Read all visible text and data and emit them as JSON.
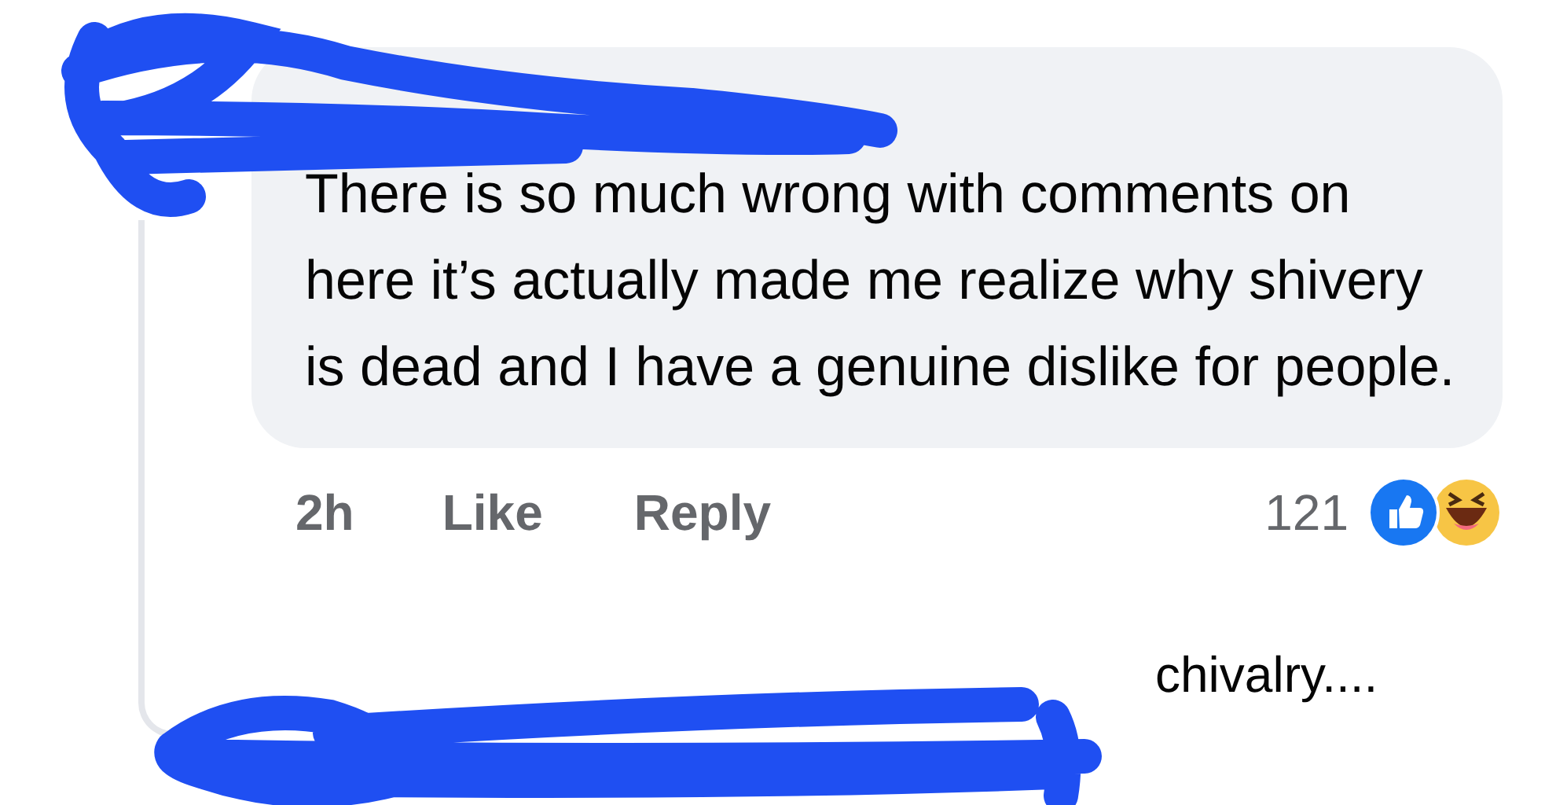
{
  "comment": {
    "text": "There is so much wrong with comments on here it’s actually made me realize why shivery is dead and I have a genuine dislike for people.",
    "time": "2h",
    "actions": [
      "Like",
      "Reply"
    ],
    "reaction_count": "121"
  },
  "reply_preview": {
    "text": "chivalry...."
  }
}
